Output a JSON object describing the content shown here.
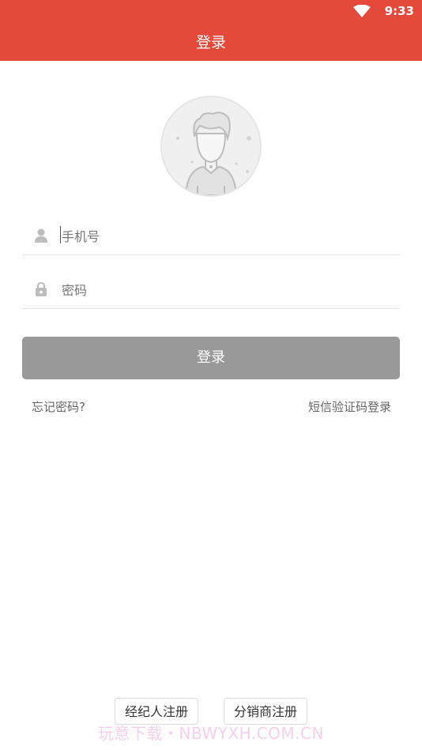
{
  "status_bar": {
    "time": "9:33",
    "icon": "wifi-icon"
  },
  "app_bar": {
    "title": "登录",
    "color": "#e5493a"
  },
  "avatar": {
    "icon": "default-avatar-icon"
  },
  "form": {
    "phone": {
      "placeholder": "手机号",
      "icon": "user-icon"
    },
    "password": {
      "placeholder": "密码",
      "icon": "lock-icon"
    },
    "login_label": "登录",
    "login_button_color": "#999999"
  },
  "links": {
    "forgot": "忘记密码?",
    "sms_login": "短信验证码登录"
  },
  "register": {
    "broker": "经纪人注册",
    "distributor": "分销商注册"
  },
  "watermark": "玩意下载・NBWYXH.COM.CN"
}
